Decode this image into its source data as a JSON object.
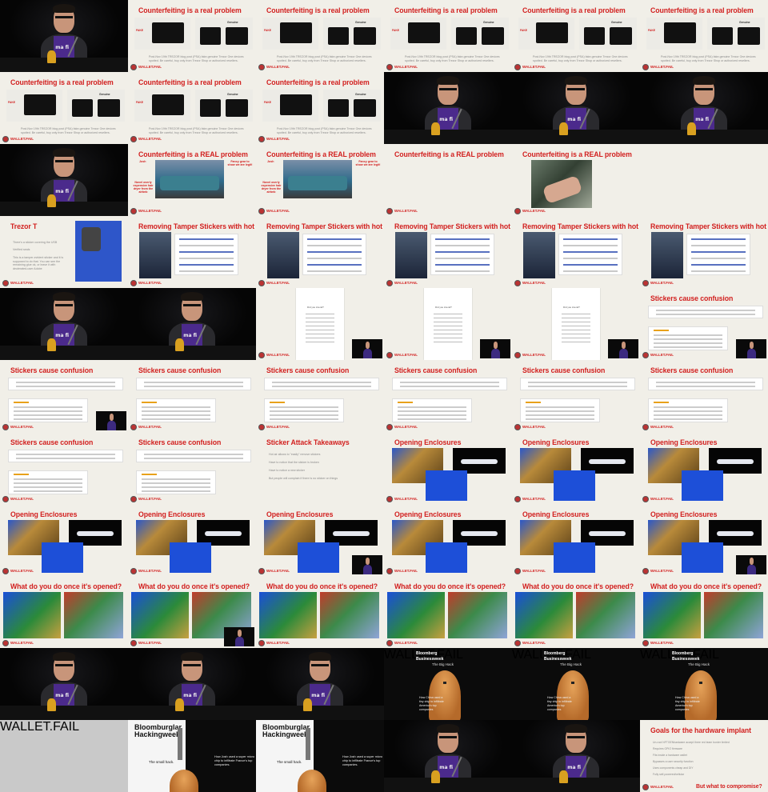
{
  "labels": {
    "brand": "WALLET.FAIL",
    "counterfeiting": "Counterfeiting is a real problem",
    "counterfeiting_caps": "Counterfeiting is a REAL problem",
    "counterfeit_bullets": "Post-Nov 19th TREZOR blog post (PSA) fake-genuine Trezor One devices spotted. Be careful, buy only from Trezor Shop or authorized resellers.",
    "counterfeit_fake_label": "FAKE",
    "counterfeit_genuine_label": "Genuine",
    "fancy_gear": "Fancy gear to show we are legit!",
    "josh": "Josh",
    "hair_dryer": "Novel overly expensive hair dryer from the airbnb",
    "trezor_t": "Trezor T",
    "trezor_t_b1": "There's a sticker covering the USB",
    "trezor_t_b2": "Verified seals",
    "trezor_t_b3": "This is a tamper-evident sticker and it is supposed to do that. You can see the remaining glue ok, or leave it with deuterated-user Adobe",
    "removing_stickers": "Removing Tamper Stickers with hot air",
    "stickers_confusion": "Stickers cause confusion",
    "sticker_takeaways": "Sticker Attack Takeaways",
    "takeaway_bullets": [
      "Hot air allows to \"easily\" remove stickers",
      "Have to notice that the sticker is broken",
      "Have to notice a new sticker",
      "But people will complain if there is no sticker on things"
    ],
    "opening_enclosures": "Opening Enclosures",
    "what_do_you_do": "What do you do once it's opened?",
    "bloomberg_businessweek": "Bloomberg Businessweek",
    "big_hack": "The Big Hack",
    "big_hack_sub": "How China used a tiny chip to infiltrate America's top companies",
    "bloomburglar": "Bloomburglar Hackingweek",
    "small_hack": "The small hack.",
    "small_hack_sub": "How Josh used a super micro chip to infiltrate France's top companies.",
    "goals": "Goals for the hardware implant",
    "goals_bullets": [
      "Un-root NFTGENhardware accept three red team border limited",
      "Requires GPIO firmware",
      "Fits inside a hardware wallet",
      "Bypasses a user security function",
      "Uses components cheap and DIY",
      "Fully self-powered/cellular"
    ],
    "but_what": "But what to compromise?",
    "shirt_text": "ma fi",
    "doc_header": "Did you intend?"
  },
  "layout_note_none": "",
  "grid": {
    "cols": 6,
    "rows": 11,
    "frames": [
      [
        "speaker",
        "counter_fb",
        "counter",
        "counter",
        "counter",
        "counter"
      ],
      [
        "counter",
        "counter",
        "counter",
        "speaker",
        "speaker",
        "speaker"
      ],
      [
        "speaker",
        "real_josh",
        "real_josh",
        "real_plain",
        "real_closeup",
        "blank_light"
      ],
      [
        "trezor_t",
        "removing",
        "removing",
        "removing",
        "removing",
        "removing"
      ],
      [
        "speaker",
        "speaker",
        "doc_only",
        "doc_pip",
        "doc_pip",
        "stickers_pip"
      ],
      [
        "stickers_pip",
        "stickers",
        "stickers",
        "stickers",
        "stickers",
        "stickers"
      ],
      [
        "stickers",
        "stickers",
        "takeaways",
        "enclosures_a",
        "enclosures_a"
      ],
      [
        "enclosures",
        "enclosures",
        "enclosures_pip",
        "enclosures",
        "enclosures",
        "enclosures_pip"
      ],
      [
        "opened",
        "opened_pip",
        "opened",
        "opened",
        "opened",
        "opened"
      ],
      [
        "speaker",
        "speaker",
        "speaker",
        "bigbloom",
        "bigbloom",
        "bigbloom"
      ],
      [
        "gray",
        "hackingweek",
        "hackingweek",
        "speaker",
        "speaker",
        "goals"
      ]
    ]
  },
  "colors": {
    "title_red": "#d2201f",
    "slide_bg": "#f1efe8",
    "purple_shirt": "#4b2a8c"
  }
}
